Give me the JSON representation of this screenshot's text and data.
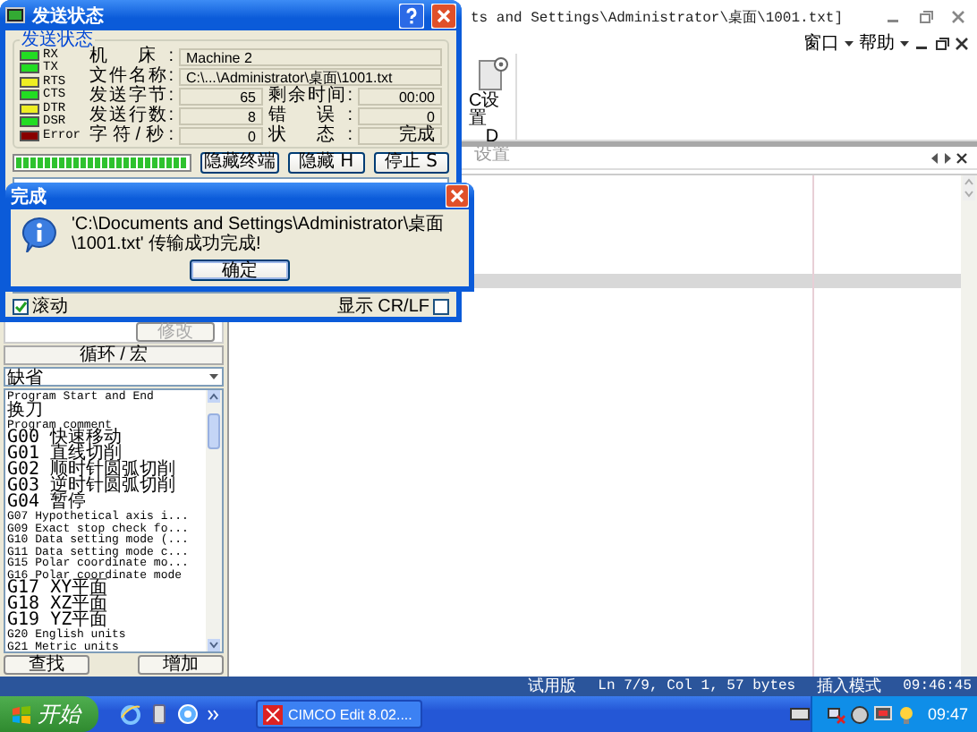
{
  "window": {
    "title": "ts and Settings\\Administrator\\桌面\\1001.txt]"
  },
  "menu": [
    {
      "label": "窗口"
    },
    {
      "label": "帮助"
    }
  ],
  "toolbar": {
    "button_lines": [
      "C设置",
      "D"
    ],
    "group_label": "设置"
  },
  "macro_panel": {
    "edit_button": {
      "label": "修改",
      "disabled": true
    },
    "title": "循环 / 宏",
    "dropdown": {
      "value": "缺省"
    },
    "items": [
      "Program Start and End",
      "换刀",
      "Program comment",
      "G00 快速移动",
      "G01 直线切削",
      "G02 顺时针圆弧切削",
      "G03 逆时针圆弧切削",
      "G04 暂停",
      "G07 Hypothetical axis i...",
      "G09 Exact stop check fo...",
      "G10 Data setting mode (...",
      "G11 Data setting mode c...",
      "G15 Polar coordinate mo...",
      "G16 Polar coordinate mode",
      "G17 XY平面",
      "G18 XZ平面",
      "G19 YZ平面",
      "G20 English units",
      "G21 Metric units"
    ],
    "buttons": [
      {
        "label": "查找"
      },
      {
        "label": "增加"
      }
    ]
  },
  "status_bar": {
    "items": [
      "试用版",
      "Ln 7/9, Col 1, 57 bytes",
      "插入模式",
      "09:46:45"
    ]
  },
  "send_dialog": {
    "title": "发送状态",
    "group_title": "发送状态",
    "signals": [
      {
        "name": "RX",
        "color": "#22dd22"
      },
      {
        "name": "TX",
        "color": "#22dd22"
      },
      {
        "name": "RTS",
        "color": "#eeee22"
      },
      {
        "name": "CTS",
        "color": "#22dd22"
      },
      {
        "name": "DTR",
        "color": "#eeee22"
      },
      {
        "name": "DSR",
        "color": "#22dd22"
      },
      {
        "name": "Error",
        "color": "#880000"
      }
    ],
    "fields": [
      {
        "label": "机 床:",
        "value": "Machine 2",
        "kind": "wide"
      },
      {
        "label": "文件名称:",
        "value": "C:\\...\\Administrator\\桌面\\1001.txt",
        "kind": "wide"
      },
      {
        "label": "发送字节:",
        "value": "65",
        "kind": "short"
      },
      {
        "label": "剩余时间:",
        "value": "00:00",
        "kind": "short"
      },
      {
        "label": "发送行数:",
        "value": "8",
        "kind": "short"
      },
      {
        "label": "错 误:",
        "value": "0",
        "kind": "short"
      },
      {
        "label": "字符/秒:",
        "value": "0",
        "kind": "short"
      },
      {
        "label": "状 态:",
        "value": "完成",
        "kind": "short"
      }
    ],
    "progress": {
      "level": 1
    },
    "buttons": [
      {
        "label": "隐藏终端"
      },
      {
        "label": "隐藏 H"
      },
      {
        "label": "停止 S"
      }
    ],
    "scroll": {
      "label": "滚动",
      "checked": true
    },
    "show_crlf": {
      "label": "显示 CR/LF",
      "checked": false
    }
  },
  "message_box": {
    "title": "完成",
    "message": "'C:\\Documents and Settings\\Administrator\\桌面\\1001.txt' 传输成功完成!",
    "button": "确定"
  },
  "taskbar": {
    "start": "开始",
    "tasks": [
      {
        "label": "CIMCO Edit 8.02....",
        "selected": false
      }
    ],
    "clock": "09:47"
  }
}
